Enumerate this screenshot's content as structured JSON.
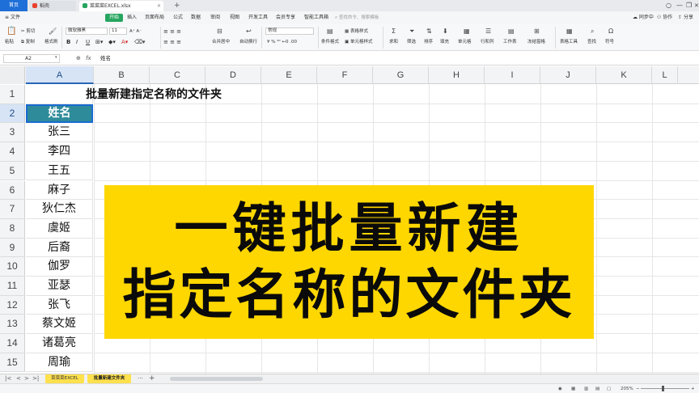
{
  "tabs": {
    "home": "首页",
    "doc": "稻壳",
    "file": "菜菜菜EXCEL.xlsx",
    "add": "+"
  },
  "window": {
    "avatar": "○",
    "minimize": "—",
    "maximize": "❐",
    "close": "✕"
  },
  "menu": {
    "file": "文件",
    "items": [
      "开始",
      "插入",
      "页面布局",
      "公式",
      "数据",
      "审阅",
      "视图",
      "开发工具",
      "会员专享",
      "智能工具箱"
    ],
    "search_placeholder": "查找命令、搜索模板",
    "sync": "同步中",
    "collab": "协作",
    "share": "分享"
  },
  "ribbon": {
    "cut": "剪切",
    "copy": "复制",
    "format_painter": "格式刷",
    "paste": "粘贴",
    "font_name": "微软雅黑",
    "font_size": "11",
    "bold": "B",
    "italic": "I",
    "underline": "U",
    "merge_center": "合并居中",
    "wrap": "自动换行",
    "number_format": "常规",
    "cond_format": "条件格式",
    "table_style": "表格样式",
    "cell_style": "单元格样式",
    "sum": "求和",
    "filter": "筛选",
    "sort": "排序",
    "fill": "填充",
    "cells": "单元格",
    "row_col": "行和列",
    "worksheet": "工作表",
    "freeze": "冻结窗格",
    "table_tools": "表格工具",
    "find": "查找",
    "symbol": "符号"
  },
  "formula_bar": {
    "cell_ref": "A2",
    "fx": "fx",
    "zoom_icon": "⊕",
    "content": "姓名"
  },
  "columns": [
    "A",
    "B",
    "C",
    "D",
    "E",
    "F",
    "G",
    "H",
    "I",
    "J",
    "K",
    "L"
  ],
  "rows": [
    "1",
    "2",
    "3",
    "4",
    "5",
    "6",
    "7",
    "8",
    "9",
    "10",
    "11",
    "12",
    "13",
    "14",
    "15"
  ],
  "title_cell": "批量新建指定名称的文件夹",
  "column_a": [
    "",
    "姓名",
    "张三",
    "李四",
    "王五",
    "麻子",
    "狄仁杰",
    "虞姬",
    "后裔",
    "伽罗",
    "亚瑟",
    "张飞",
    "蔡文姬",
    "诸葛亮",
    "周瑜"
  ],
  "banner": {
    "line1": "一键批量新建",
    "line2": "指定名称的文件夹",
    "color": "#ffd700"
  },
  "sheets": {
    "nav": [
      "|<",
      "<",
      ">",
      ">|"
    ],
    "names": [
      "菜菜菜EXCEL",
      "批量新建文件夹"
    ],
    "more": "···",
    "add": "+"
  },
  "status": {
    "zoom": "205%",
    "minus": "−",
    "plus": "+"
  }
}
